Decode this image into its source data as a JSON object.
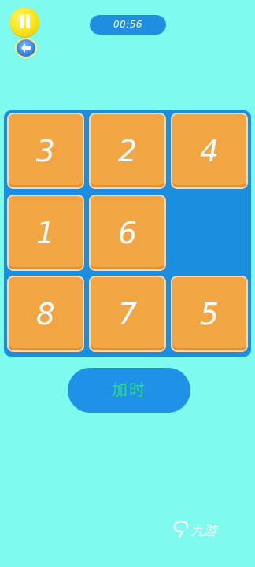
{
  "header": {
    "timer": "00:56",
    "pause_icon": "pause-icon",
    "back_icon": "back-arrow-icon"
  },
  "puzzle": {
    "rows": [
      [
        "3",
        "2",
        "4"
      ],
      [
        "1",
        "6",
        ""
      ],
      [
        "8",
        "7",
        "5"
      ]
    ],
    "empty_cell": {
      "row": 2,
      "col": 3
    }
  },
  "actions": {
    "add_time_label": "加时"
  },
  "watermark": {
    "text": "九游",
    "icon": "jiuyou-logo-icon"
  },
  "colors": {
    "background": "#7ffaee",
    "board": "#1b8ee0",
    "tile": "#f6a640",
    "tile_border": "#f3dcc0",
    "tile_text": "#ffffff",
    "timer_bg": "#1e8fe0",
    "button_bg": "#1f91e6",
    "button_text": "#27e07a",
    "pause_button": "#f7e21a"
  }
}
